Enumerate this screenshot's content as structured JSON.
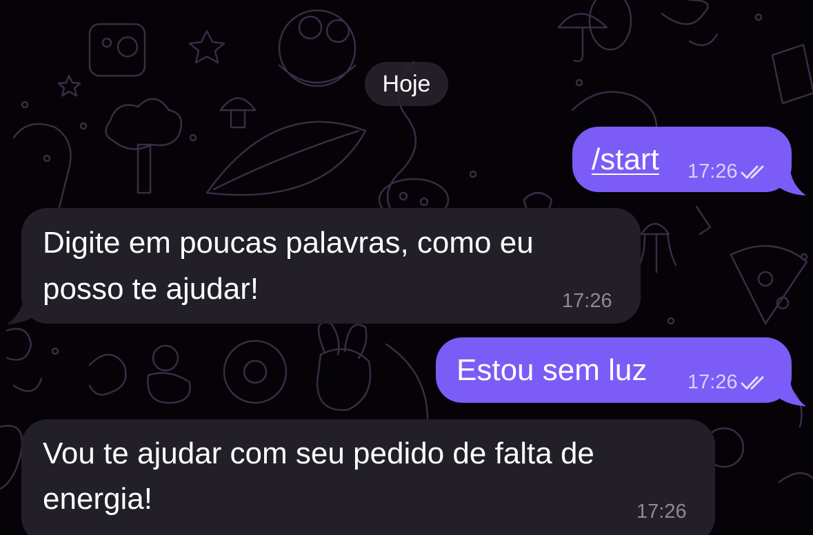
{
  "chat": {
    "date_separator": "Hoje",
    "messages": [
      {
        "direction": "outgoing",
        "text": "/start",
        "time": "17:26",
        "status": "read"
      },
      {
        "direction": "incoming",
        "lines": [
          "Digite em poucas palavras, como eu",
          "posso te ajudar!"
        ],
        "time": "17:26"
      },
      {
        "direction": "outgoing",
        "text": "Estou sem luz",
        "time": "17:26",
        "status": "read"
      },
      {
        "direction": "incoming",
        "lines": [
          "Vou te ajudar com seu pedido de falta de",
          "energia!"
        ],
        "time": "17:26"
      }
    ]
  },
  "theme": {
    "background": "#050308",
    "outgoing_bubble": "#7b5cf6",
    "incoming_bubble": "#231f28",
    "wallpaper_line": "#3a2c45"
  },
  "icons": {
    "read_receipt": "double-check-icon",
    "wallpaper": "doodle-pattern"
  }
}
